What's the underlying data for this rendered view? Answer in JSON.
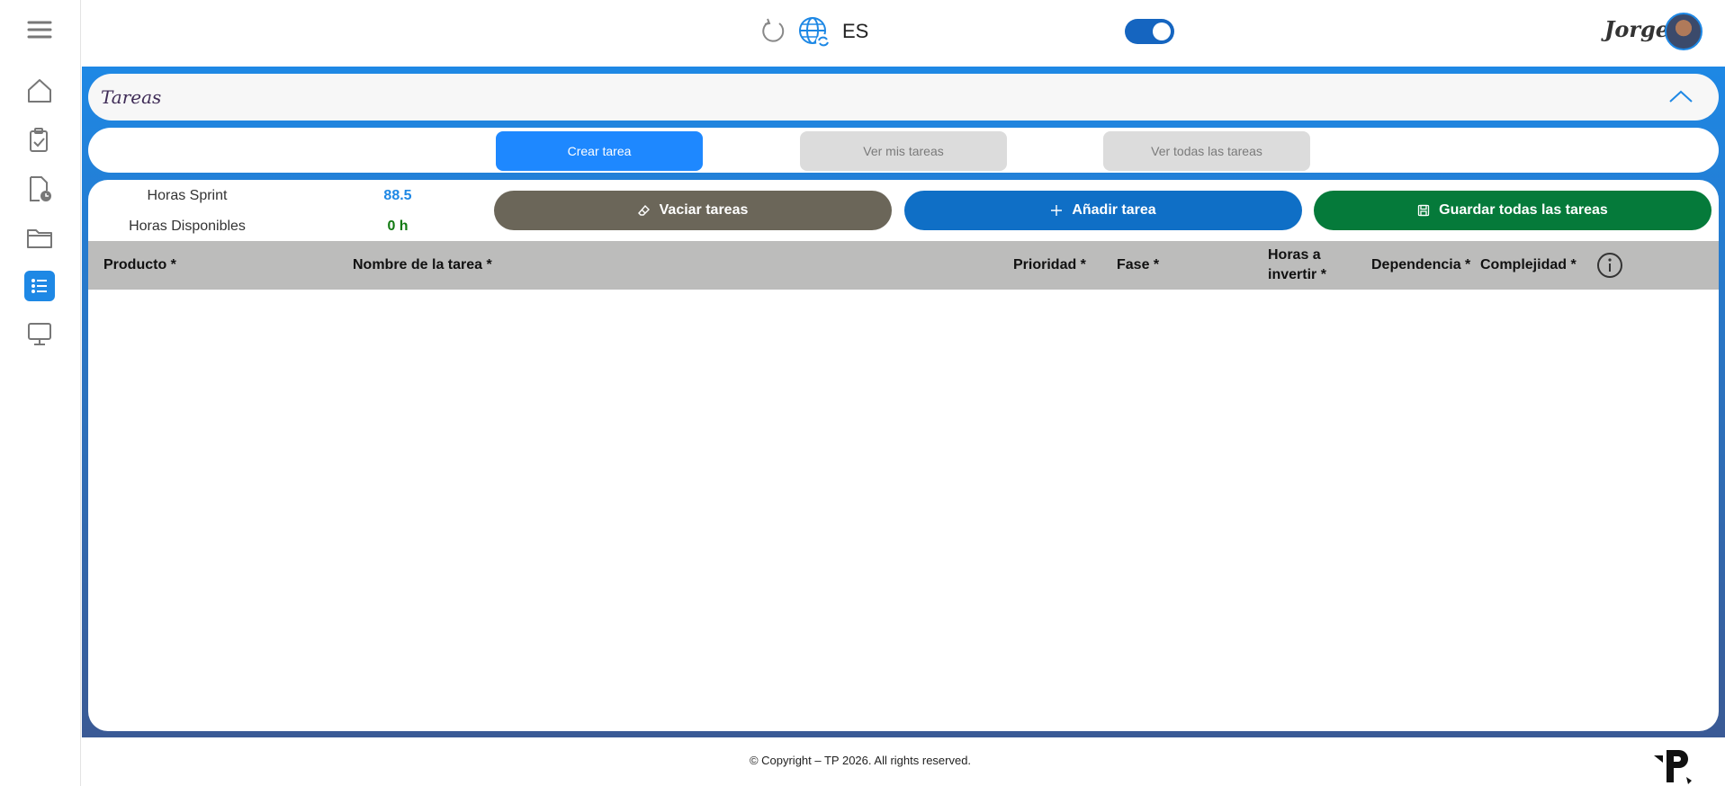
{
  "header": {
    "language": "ES",
    "username": "Jorge"
  },
  "colors": {
    "primary": "#1e88ff",
    "frame_top": "#1e88e5",
    "frame_bottom": "#3a5a95",
    "clear_button": "#6b6659",
    "add_button": "#0f6fc6",
    "save_button": "#057a3a",
    "sprint_value": "#1e88e5",
    "available_value": "#127a12"
  },
  "sidebar": {
    "items": [
      {
        "icon": "menu-icon"
      },
      {
        "icon": "home-icon"
      },
      {
        "icon": "clipboard-check-icon"
      },
      {
        "icon": "document-clock-icon"
      },
      {
        "icon": "folder-icon"
      },
      {
        "icon": "list-icon",
        "active": true
      },
      {
        "icon": "monitor-icon"
      }
    ]
  },
  "page": {
    "title": "Tareas"
  },
  "tabs": [
    {
      "label": "Crear tarea",
      "active": true
    },
    {
      "label": "Ver mis tareas",
      "active": false
    },
    {
      "label": "Ver todas las tareas",
      "active": false
    }
  ],
  "hours": {
    "sprint_label": "Horas Sprint",
    "sprint_value": "88.5",
    "available_label": "Horas Disponibles",
    "available_value": "0 h"
  },
  "actions": {
    "clear": "Vaciar tareas",
    "add": "Añadir tarea",
    "save": "Guardar todas las tareas"
  },
  "table": {
    "columns": {
      "product": "Producto *",
      "task_name": "Nombre de la tarea *",
      "priority": "Prioridad *",
      "phase": "Fase *",
      "hours_line1": "Horas a",
      "hours_line2": "invertir *",
      "dependency": "Dependencia *",
      "complexity": "Complejidad *"
    },
    "rows": []
  },
  "footer": {
    "copyright": "© Copyright – TP 2026. All rights reserved."
  }
}
